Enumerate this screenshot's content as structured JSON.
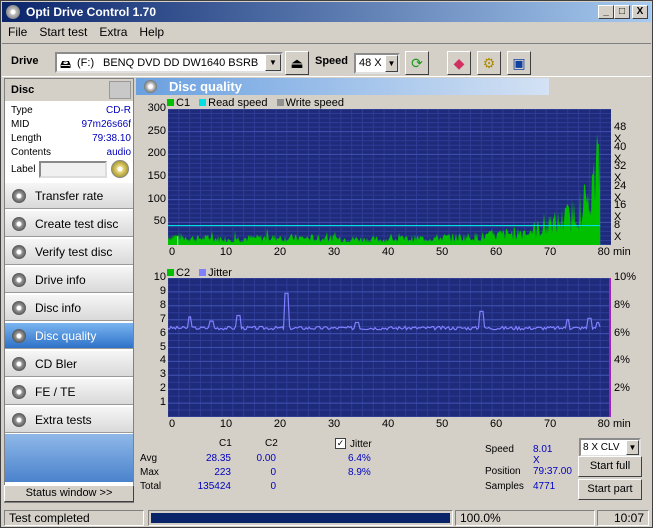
{
  "window": {
    "title": "Opti Drive Control 1.70",
    "min": "_",
    "max": "□",
    "close": "X"
  },
  "menu": [
    "File",
    "Start test",
    "Extra",
    "Help"
  ],
  "toolbar": {
    "drive_label": "Drive",
    "drive_letter": "(F:)",
    "drive_name": "BENQ    DVD DD DW1640 BSRB",
    "speed_label": "Speed",
    "speed_value": "48 X"
  },
  "disc": {
    "header": "Disc",
    "rows": [
      {
        "k": "Type",
        "v": "CD-R"
      },
      {
        "k": "MID",
        "v": "97m26s66f"
      },
      {
        "k": "Length",
        "v": "79:38.10"
      },
      {
        "k": "Contents",
        "v": "audio"
      }
    ],
    "label_text": "Label"
  },
  "nav": [
    {
      "label": "Transfer rate",
      "active": false
    },
    {
      "label": "Create test disc",
      "active": false
    },
    {
      "label": "Verify test disc",
      "active": false
    },
    {
      "label": "Drive info",
      "active": false
    },
    {
      "label": "Disc info",
      "active": false
    },
    {
      "label": "Disc quality",
      "active": true
    },
    {
      "label": "CD Bler",
      "active": false
    },
    {
      "label": "FE / TE",
      "active": false
    },
    {
      "label": "Extra tests",
      "active": false
    }
  ],
  "status_window_btn": "Status window >>",
  "panel": {
    "title": "Disc quality",
    "legend_top": [
      {
        "name": "C1",
        "color": "#00c000"
      },
      {
        "name": "Read speed",
        "color": "#00e0e0"
      },
      {
        "name": "Write speed",
        "color": "#909090"
      }
    ],
    "legend_bottom": [
      {
        "name": "C2",
        "color": "#00c000"
      },
      {
        "name": "Jitter",
        "color": "#8080ff"
      }
    ]
  },
  "chart_data": [
    {
      "type": "area",
      "series": [
        {
          "name": "C1",
          "color": "#00c000"
        },
        {
          "name": "Read speed",
          "color": "#00e0e0",
          "values": [
            8,
            8
          ]
        }
      ],
      "x_ticks": [
        "0",
        "10",
        "20",
        "30",
        "40",
        "50",
        "60",
        "70",
        "80 min"
      ],
      "y_ticks": [
        "300",
        "250",
        "200",
        "150",
        "100",
        "50"
      ],
      "y_right_ticks": [
        "48 X",
        "40 X",
        "32 X",
        "24 X",
        "16 X",
        "8 X"
      ],
      "xlim": [
        0,
        82
      ],
      "ylim": [
        0,
        300
      ],
      "c1_profile": {
        "x": [
          0,
          5,
          10,
          20,
          30,
          40,
          50,
          60,
          65,
          70,
          74,
          77,
          79,
          80
        ],
        "y": [
          20,
          15,
          14,
          16,
          15,
          12,
          16,
          20,
          28,
          40,
          60,
          90,
          130,
          200
        ]
      },
      "c1_max": 223,
      "speed_x": 8
    },
    {
      "type": "line",
      "series": [
        {
          "name": "C2",
          "color": "#00c000",
          "values": [
            0
          ]
        },
        {
          "name": "Jitter",
          "color": "#8080ff"
        }
      ],
      "x_ticks": [
        "0",
        "10",
        "20",
        "30",
        "40",
        "50",
        "60",
        "70",
        "80 min"
      ],
      "y_ticks": [
        "10",
        "9",
        "8",
        "7",
        "6",
        "5",
        "4",
        "3",
        "2",
        "1"
      ],
      "y_right_ticks": [
        "10%",
        "8%",
        "6%",
        "4%",
        "2%"
      ],
      "xlim": [
        0,
        82
      ],
      "ylim": [
        0,
        10
      ],
      "jitter_base": 6.4,
      "jitter_spikes": [
        [
          4,
          7.2
        ],
        [
          8,
          6.9
        ],
        [
          13,
          7.3
        ],
        [
          22,
          8.9
        ],
        [
          35,
          6.8
        ],
        [
          58,
          7.6
        ],
        [
          74,
          7.0
        ],
        [
          78,
          7.1
        ],
        [
          79.5,
          6.8
        ]
      ]
    }
  ],
  "stats": {
    "col_c1": "C1",
    "col_c2": "C2",
    "jitter_label": "Jitter",
    "avg_label": "Avg",
    "avg_c1": "28.35",
    "avg_c2": "0.00",
    "avg_j": "6.4%",
    "max_label": "Max",
    "max_c1": "223",
    "max_c2": "0",
    "max_j": "8.9%",
    "total_label": "Total",
    "total_c1": "135424",
    "total_c2": "0"
  },
  "right_info": {
    "speed_label": "Speed",
    "speed_val": "8.01 X",
    "speed_select": "8 X CLV",
    "position_label": "Position",
    "position_val": "79:37.00",
    "samples_label": "Samples",
    "samples_val": "4771",
    "start_full": "Start full",
    "start_part": "Start part"
  },
  "statusbar": {
    "text": "Test completed",
    "progress": "100.0%",
    "progress_value": 1.0,
    "time": "10:07"
  }
}
